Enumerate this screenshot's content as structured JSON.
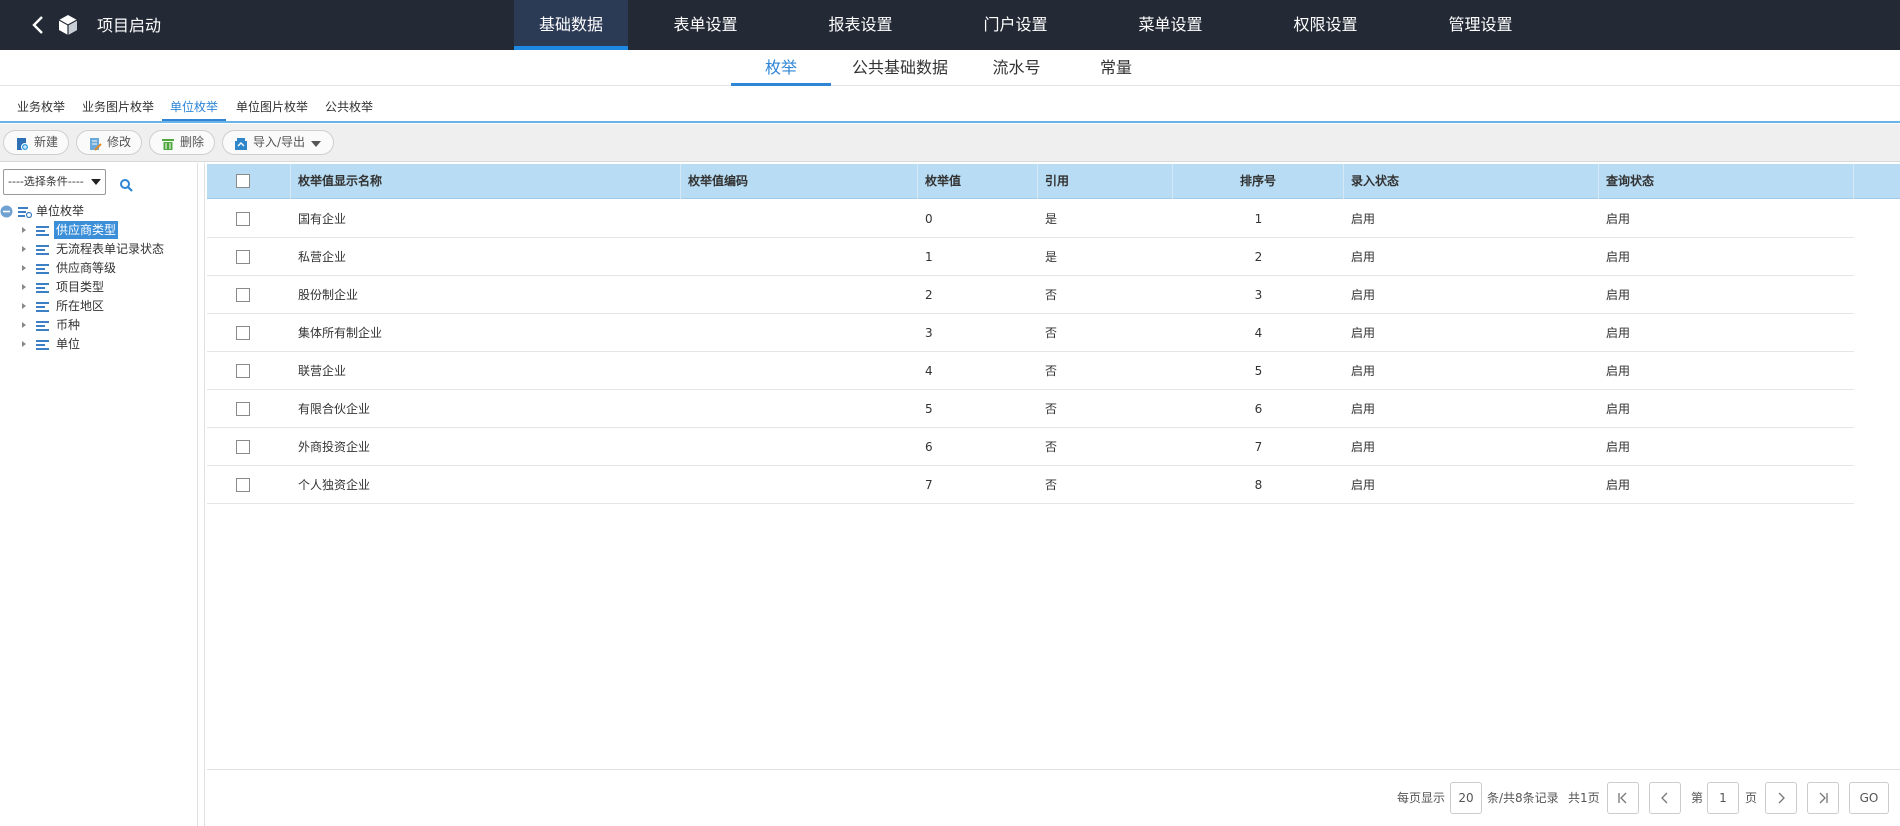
{
  "header": {
    "app_title": "项目启动",
    "nav": [
      "基础数据",
      "表单设置",
      "报表设置",
      "门户设置",
      "菜单设置",
      "权限设置",
      "管理设置"
    ]
  },
  "subtabs": [
    "枚举",
    "公共基础数据",
    "流水号",
    "常量"
  ],
  "typetabs": [
    "业务枚举",
    "业务图片枚举",
    "单位枚举",
    "单位图片枚举",
    "公共枚举"
  ],
  "toolbar": {
    "new_label": "新建",
    "edit_label": "修改",
    "delete_label": "删除",
    "import_export_label": "导入/导出"
  },
  "leftpanel": {
    "select_value": "----选择条件----",
    "root_label": "单位枚举",
    "nodes": [
      "供应商类型",
      "无流程表单记录状态",
      "供应商等级",
      "项目类型",
      "所在地区",
      "币种",
      "单位"
    ]
  },
  "table": {
    "columns": [
      "枚举值显示名称",
      "枚举值编码",
      "枚举值",
      "引用",
      "排序号",
      "录入状态",
      "查询状态"
    ],
    "rows": [
      [
        "国有企业",
        "",
        "0",
        "是",
        "1",
        "启用",
        "启用"
      ],
      [
        "私营企业",
        "",
        "1",
        "是",
        "2",
        "启用",
        "启用"
      ],
      [
        "股份制企业",
        "",
        "2",
        "否",
        "3",
        "启用",
        "启用"
      ],
      [
        "集体所有制企业",
        "",
        "3",
        "否",
        "4",
        "启用",
        "启用"
      ],
      [
        "联营企业",
        "",
        "4",
        "否",
        "5",
        "启用",
        "启用"
      ],
      [
        "有限合伙企业",
        "",
        "5",
        "否",
        "6",
        "启用",
        "启用"
      ],
      [
        "外商投资企业",
        "",
        "6",
        "否",
        "7",
        "启用",
        "启用"
      ],
      [
        "个人独资企业",
        "",
        "7",
        "否",
        "8",
        "启用",
        "启用"
      ]
    ]
  },
  "pager": {
    "per_page_label": "每页显示",
    "per_page_value": "20",
    "total_label": "条/共8条记录",
    "pages_label": "共1页",
    "page_prefix": "第",
    "page_value": "1",
    "page_suffix": "页",
    "go_label": "GO"
  }
}
